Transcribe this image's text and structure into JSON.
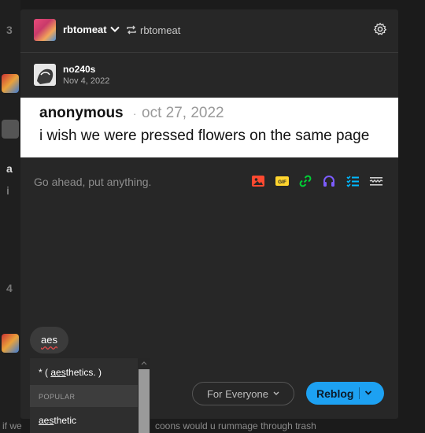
{
  "background": {
    "marks": [
      "3",
      "a",
      "i",
      "4"
    ],
    "bottom_text_left": "if we",
    "bottom_text_right": "coons would u rummage through trash"
  },
  "header": {
    "blog_name": "rbtomeat",
    "reblog_source": "rbtomeat",
    "icons": [
      "chevron-down-icon",
      "reblog-icon",
      "gear-icon"
    ]
  },
  "post": {
    "author": "no240s",
    "date": "Nov 4, 2022"
  },
  "ask": {
    "asker": "anonymous",
    "separator": "·",
    "asked_date": "oct 27, 2022",
    "question": "i wish we were pressed flowers on the same page"
  },
  "editor": {
    "placeholder": "Go ahead, put anything.",
    "tools": [
      "image-icon",
      "gif-icon",
      "link-icon",
      "audio-icon",
      "checklist-icon",
      "readmore-icon"
    ],
    "tool_colors": {
      "image": "#ff4930",
      "gif": "#ffd52e",
      "link": "#00cf35",
      "audio": "#7c5cff",
      "checklist": "#00b8ff",
      "readmore": "#cfcfcf"
    }
  },
  "tags": {
    "current_input": "aes"
  },
  "dropdown": {
    "first_item": "* ( aesthetics. )",
    "first_item_pre": "* ( ",
    "first_item_match": "aes",
    "first_item_rest": "thetics. )",
    "section_label": "POPULAR",
    "second_item_match": "aes",
    "second_item_rest": "thetic"
  },
  "footer": {
    "audience_label": "For Everyone",
    "submit_label": "Reblog",
    "accent": "#1da1f2"
  }
}
